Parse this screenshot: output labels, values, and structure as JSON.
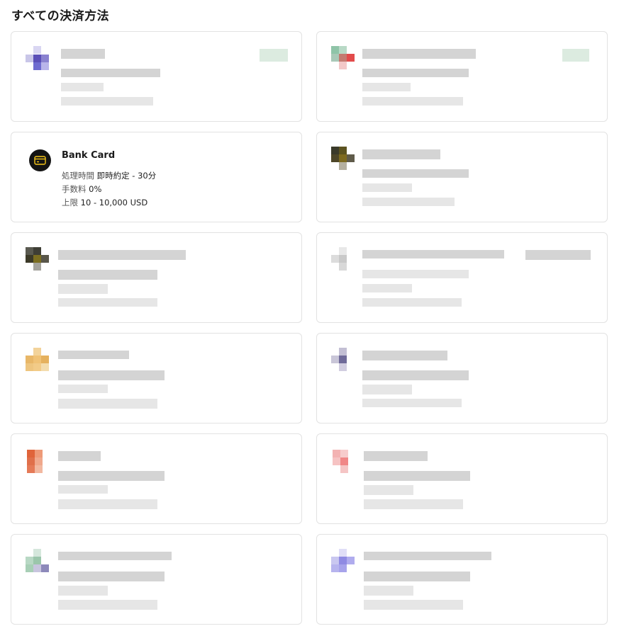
{
  "page": {
    "title": "すべての決済方法"
  },
  "cards": {
    "bank_card": {
      "name": "Bank Card",
      "processing_label": "処理時間",
      "processing_value": "即時約定 - 30分",
      "fee_label": "手数料",
      "fee_value": "0%",
      "limit_label": "上限",
      "limit_value": "10 - 10,000 USD",
      "icon": "credit-card-icon"
    }
  },
  "colors": {
    "border": "#e2e2e2",
    "icon_bg": "#141414",
    "icon_accent": "#f5c518"
  }
}
